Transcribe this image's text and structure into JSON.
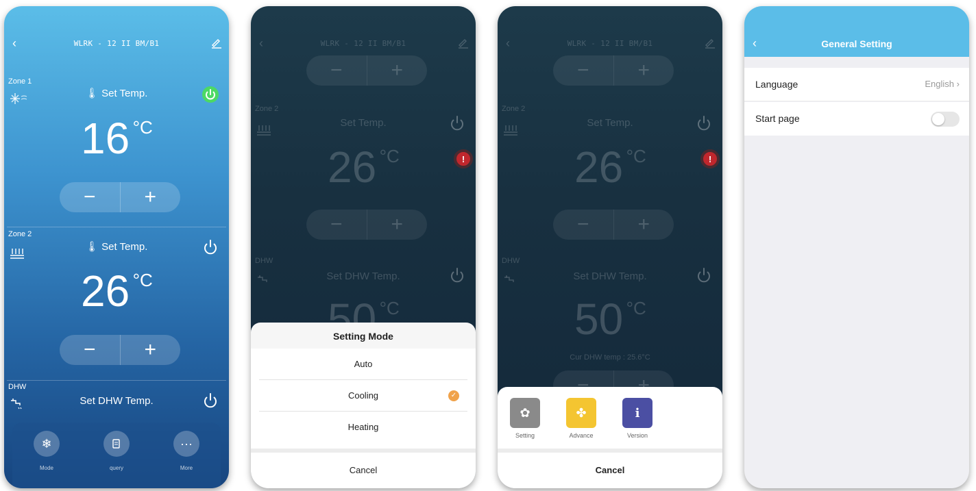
{
  "screen1": {
    "title": "WLRK - 12 II BM/B1",
    "zone1": {
      "label": "Zone 1",
      "set_label": "Set Temp.",
      "temp": "16",
      "unit": "°C"
    },
    "zone2": {
      "label": "Zone 2",
      "set_label": "Set Temp.",
      "temp": "26",
      "unit": "°C"
    },
    "dhw": {
      "label": "DHW",
      "set_label": "Set DHW Temp."
    },
    "stepper": {
      "minus": "−",
      "plus": "+"
    },
    "bottom_bar": [
      {
        "label": "Mode",
        "icon": "snowflake-icon"
      },
      {
        "label": "query",
        "icon": "query-icon"
      },
      {
        "label": "More",
        "icon": "more-icon"
      }
    ]
  },
  "screen2": {
    "title": "WLRK - 12 II BM/B1",
    "zone2": {
      "label": "Zone 2",
      "set_label": "Set Temp.",
      "temp": "26",
      "unit": "°C"
    },
    "dhw": {
      "label": "DHW",
      "set_label": "Set DHW Temp.",
      "temp": "50",
      "unit": "°C"
    },
    "sheet": {
      "title": "Setting Mode",
      "options": [
        "Auto",
        "Cooling",
        "Heating"
      ],
      "selected": "Cooling",
      "cancel": "Cancel"
    }
  },
  "screen3": {
    "title": "WLRK - 12 II BM/B1",
    "zone2": {
      "label": "Zone 2",
      "set_label": "Set Temp.",
      "temp": "26",
      "unit": "°C"
    },
    "dhw": {
      "label": "DHW",
      "set_label": "Set DHW Temp.",
      "temp": "50",
      "unit": "°C",
      "current": "Cur DHW temp : 25.6°C"
    },
    "sheet": {
      "tiles": [
        {
          "label": "Setting",
          "color": "#8a8a8a",
          "icon": "gear-icon"
        },
        {
          "label": "Advance",
          "color": "#f4c531",
          "icon": "clover-icon"
        },
        {
          "label": "Version",
          "color": "#4b4fa3",
          "icon": "info-icon"
        }
      ],
      "cancel": "Cancel"
    }
  },
  "screen4": {
    "title": "General Setting",
    "rows": [
      {
        "label": "Language",
        "value": "English"
      },
      {
        "label": "Start page",
        "toggle": false
      }
    ]
  },
  "colors": {
    "accent_blue": "#5bbde8",
    "power_green": "#4cd964",
    "alert_red": "#c0272d",
    "check_orange": "#f0a24a"
  }
}
